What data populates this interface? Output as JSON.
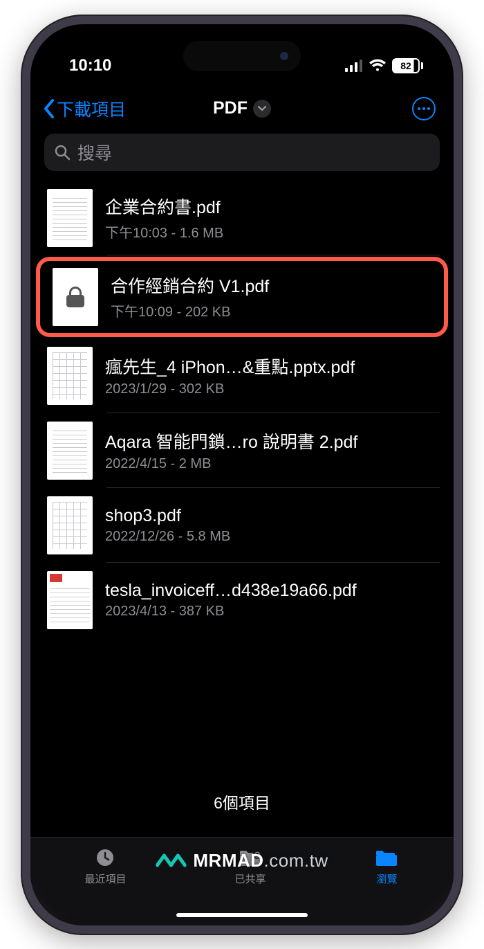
{
  "status": {
    "time": "10:10",
    "battery_pct": "82"
  },
  "nav": {
    "back_label": "下載項目",
    "title": "PDF"
  },
  "search": {
    "placeholder": "搜尋"
  },
  "files": [
    {
      "name": "企業合約書.pdf",
      "sub": "下午10:03 - 1.6 MB",
      "thumb": "doc",
      "highlight": false
    },
    {
      "name": "合作經銷合約 V1.pdf",
      "sub": "下午10:09 - 202 KB",
      "thumb": "locked",
      "highlight": true
    },
    {
      "name": "瘋先生_4 iPhon…&重點.pptx.pdf",
      "sub": "2023/1/29 - 302 KB",
      "thumb": "grid",
      "highlight": false
    },
    {
      "name": "Aqara 智能門鎖…ro 說明書 2.pdf",
      "sub": "2022/4/15 - 2 MB",
      "thumb": "doc",
      "highlight": false
    },
    {
      "name": "shop3.pdf",
      "sub": "2022/12/26 - 5.8 MB",
      "thumb": "grid",
      "highlight": false
    },
    {
      "name": "tesla_invoiceff…d438e19a66.pdf",
      "sub": "2023/4/13 - 387 KB",
      "thumb": "redtop",
      "highlight": false
    }
  ],
  "footer": {
    "count_label": "6個項目"
  },
  "tabs": {
    "recent": "最近項目",
    "shared": "已共享",
    "browse": "瀏覽"
  },
  "watermark": {
    "brand": "MRMAD",
    "suffix": ".com.tw"
  }
}
